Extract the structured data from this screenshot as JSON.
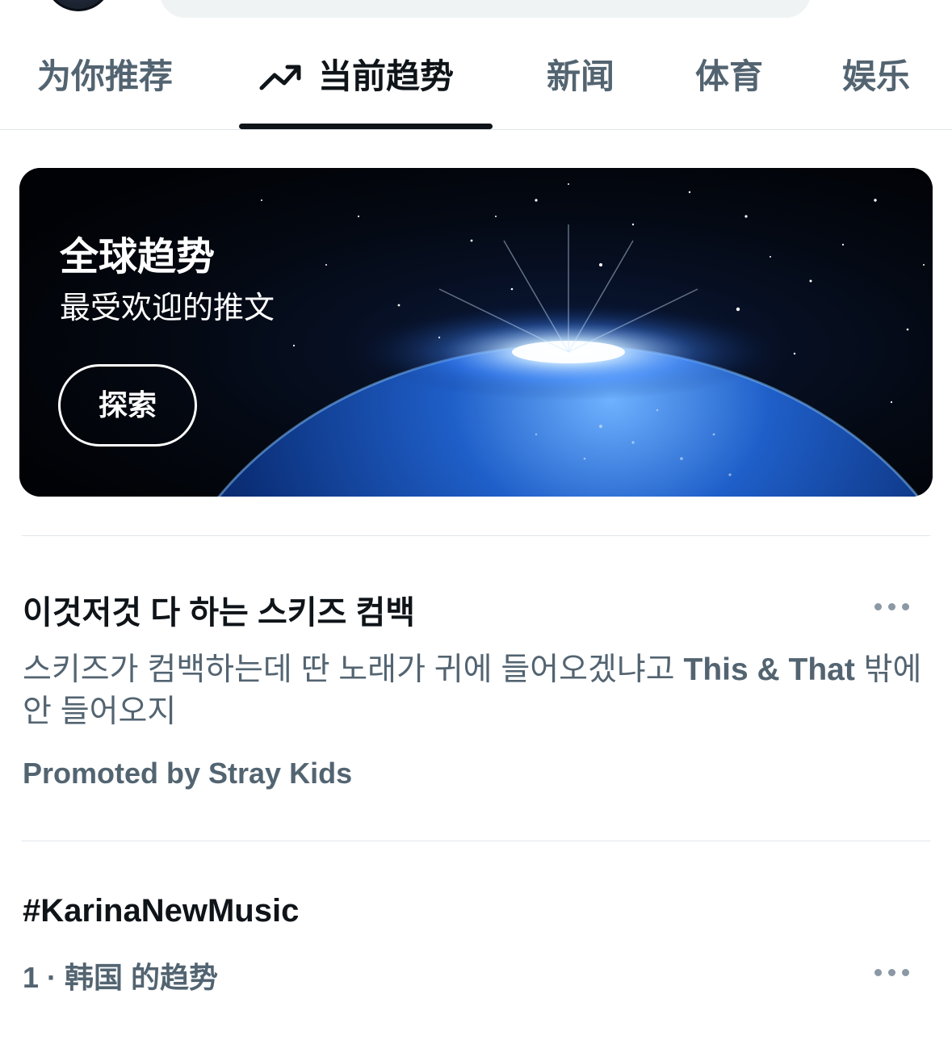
{
  "tabs": [
    {
      "label": "为你推荐",
      "active": false
    },
    {
      "label": "当前趋势",
      "active": true,
      "icon": "trending-up-icon"
    },
    {
      "label": "新闻",
      "active": false
    },
    {
      "label": "体育",
      "active": false
    },
    {
      "label": "娱乐",
      "active": false
    }
  ],
  "hero": {
    "title": "全球趋势",
    "subtitle": "最受欢迎的推文",
    "button_label": "探索"
  },
  "promoted": {
    "title": "이것저것 다 하는 스키즈 컴백",
    "description_text": "스키즈가 컴백하는데 딴 노래가 귀에 들어오겠냐고 ",
    "description_bold": "This & That",
    "description_tail": " 밖에 안 들어오지",
    "meta": "Promoted by Stray Kids"
  },
  "trend": {
    "title": "#KarinaNewMusic",
    "meta": "1 · 韩国 的趋势"
  },
  "colors": {
    "text_primary": "#0f1419",
    "text_secondary": "#536471",
    "divider": "#e1e6ea"
  }
}
